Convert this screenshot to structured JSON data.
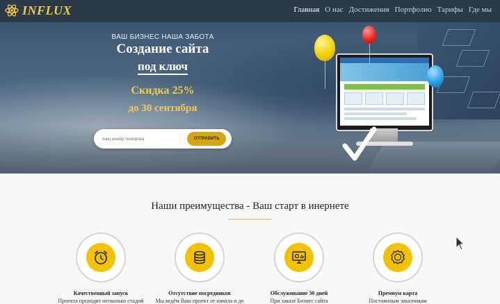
{
  "header": {
    "logo_text": "INFLUX",
    "nav": [
      "Главная",
      "О нас",
      "Достижения",
      "Портфолио",
      "Тарифы",
      "Где мы"
    ]
  },
  "hero": {
    "subtitle": "ВАШ БИЗНЕС НАША ЗАБОТА",
    "title_line1": "Создание сайта",
    "title_line2": "под ключ",
    "promo_line1": "Скидка 25%",
    "promo_line2": "до 30 сентября",
    "form": {
      "phone_placeholder": "Ваш номер телефона",
      "submit_label": "ОТПРАВИТЬ"
    },
    "monitor_tags": [
      "ERP",
      "PRODUCT",
      "MANAGEMENT",
      "MANUFACTURING",
      "SHIPPING"
    ]
  },
  "advantages": {
    "title": "Наши преимущества - Ваш старт в инернете",
    "items": [
      {
        "icon": "alarm-clock-icon",
        "title": "Качественный запуск",
        "desc": "Проекта проходит несколько стадий"
      },
      {
        "icon": "coins-stack-icon",
        "title": "Отсутствие посредников",
        "desc": "Мы ведём Ваш проект от начала и до"
      },
      {
        "icon": "monitor-chart-icon",
        "title": "Обслуживание 30 дней",
        "desc": "При заказе Бизнес сайта"
      },
      {
        "icon": "premium-badge-icon",
        "title": "Премиум карта",
        "desc": "Постоянным заказчикам"
      }
    ]
  },
  "colors": {
    "header_bg": "#2b3a47",
    "accent_yellow": "#f2c200",
    "gold_text": "#f2c94c"
  }
}
